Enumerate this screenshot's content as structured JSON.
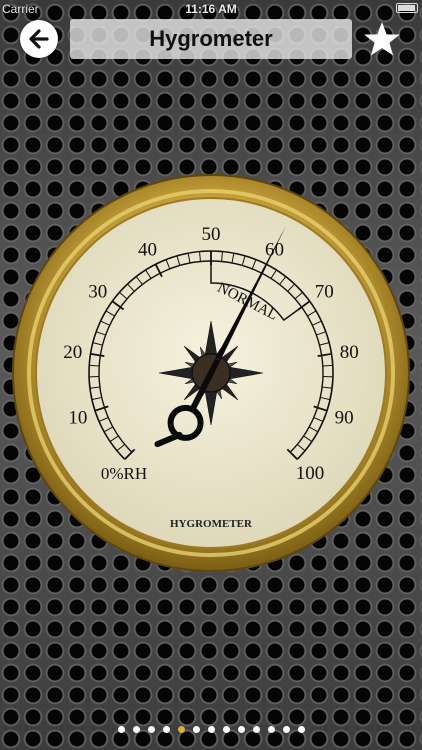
{
  "status_bar": {
    "carrier": "Carrier",
    "time": "11:16 AM"
  },
  "header": {
    "title": "Hygrometer",
    "back_icon": "arrow-left-icon",
    "favorite_icon": "star-icon"
  },
  "gauge": {
    "scale_labels": [
      "0%RH",
      "10",
      "20",
      "30",
      "40",
      "50",
      "60",
      "70",
      "80",
      "90",
      "100"
    ],
    "normal_label": "NORMAL",
    "brand_label": "HYGROMETER",
    "needle_value": 60,
    "normal_range": [
      50,
      70
    ],
    "colors": {
      "bezel": "#c9a43a",
      "face": "#efead4",
      "ink": "#111111"
    }
  },
  "pager": {
    "count": 13,
    "active_index": 4
  }
}
